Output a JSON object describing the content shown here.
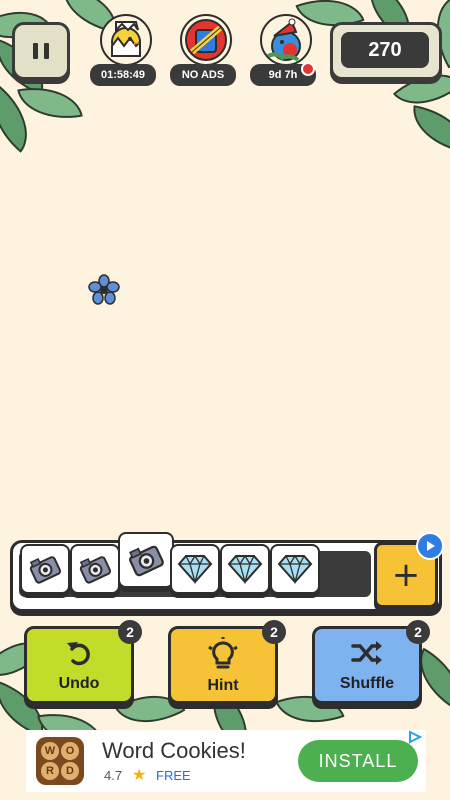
{
  "hud": {
    "pause_icon": "pause-icon",
    "events": [
      {
        "icon": "hatching-chick-icon",
        "label": "01:58:49"
      },
      {
        "icon": "remove-ads-icon",
        "label": "NO ADS"
      },
      {
        "icon": "christmas-bird-icon",
        "label": "9d 7h"
      }
    ],
    "score": "270"
  },
  "board": {
    "flower_icon": "blue-flower-icon"
  },
  "tray": {
    "tiles": [
      {
        "icon": "camera-icon"
      },
      {
        "icon": "camera-icon"
      },
      {
        "icon": "camera-icon"
      },
      {
        "icon": "diamond-icon"
      },
      {
        "icon": "diamond-icon"
      },
      {
        "icon": "diamond-icon"
      }
    ],
    "add_label": "+",
    "accent": "#f6c337"
  },
  "powerups": [
    {
      "label": "Undo",
      "count": "2",
      "color": "#c3dc2a",
      "icon": "undo-icon"
    },
    {
      "label": "Hint",
      "count": "2",
      "color": "#f6c337",
      "icon": "lightbulb-icon"
    },
    {
      "label": "Shuffle",
      "count": "2",
      "color": "#7fb3f0",
      "icon": "shuffle-icon"
    }
  ],
  "ad": {
    "app_name": "Word Cookies!",
    "rating": "4.7",
    "price": "FREE",
    "cta": "INSTALL",
    "icon_letters": [
      "W",
      "O",
      "R",
      "D"
    ],
    "cta_color": "#4caf50"
  }
}
